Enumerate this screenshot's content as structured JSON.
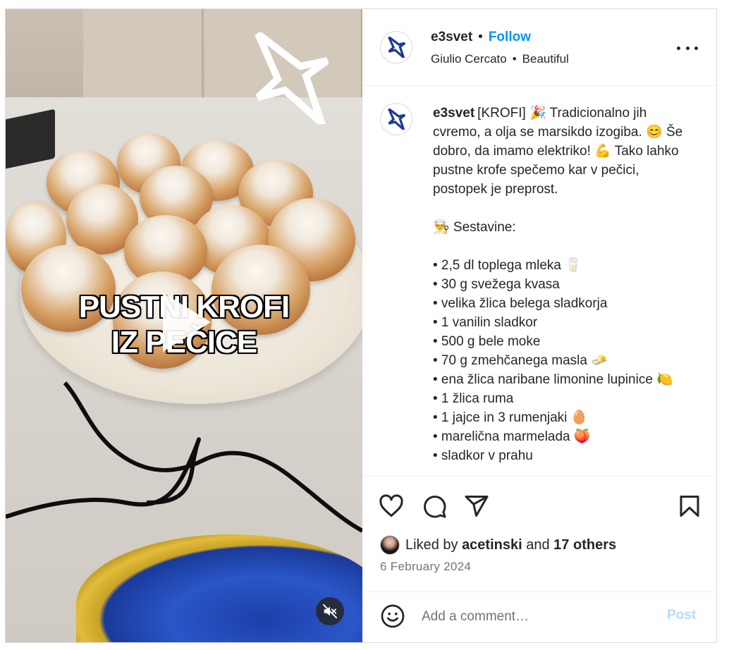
{
  "media": {
    "overlay_line1": "PUSTNI KROFI",
    "overlay_line2": "IZ PEČICE",
    "play_icon": "play-icon",
    "mute_icon": "speaker-muted-icon"
  },
  "post": {
    "username": "e3svet",
    "separator": "•",
    "follow_label": "Follow",
    "audio_artist": "Giulio Cercato",
    "audio_track": "Beautiful",
    "more_icon": "more-horizontal-icon"
  },
  "caption": {
    "username": "e3svet",
    "lines": [
      "[KROFI] 🎉 Tradicionalno jih cvremo, a olja se marsikdo izogiba. 😊 Še dobro, da imamo elektriko! 💪 Tako lahko pustne krofe spečemo kar v pečici, postopek je preprost.",
      "",
      "👨‍🍳 Sestavine:",
      "",
      "• 2,5 dl toplega mleka 🥛",
      "• 30 g svežega kvasa",
      "• velika žlica belega sladkorja",
      "• 1 vanilin sladkor",
      "• 500 g bele moke",
      "• 70 g zmehčanega masla 🧈",
      "• ena žlica naribane limonine lupinice 🍋",
      "• 1 žlica ruma",
      "• 1 jajce in 3 rumenjaki 🥚",
      "• marelična marmelada 🍑",
      "• sladkor v prahu"
    ]
  },
  "actions": {
    "like_icon": "heart-icon",
    "comment_icon": "comment-icon",
    "share_icon": "send-icon",
    "save_icon": "bookmark-icon",
    "liked_prefix": "Liked by",
    "liked_user": "acetinski",
    "liked_and": "and",
    "liked_others": "17 others",
    "date": "6 February 2024"
  },
  "comment": {
    "emoji_icon": "smiley-icon",
    "placeholder": "Add a comment…",
    "post_label": "Post"
  },
  "colors": {
    "accent_link": "#0095f6",
    "post_disabled": "#b3dbff",
    "text": "#262626",
    "muted": "#737373",
    "logo_blue": "#1f3a93"
  }
}
